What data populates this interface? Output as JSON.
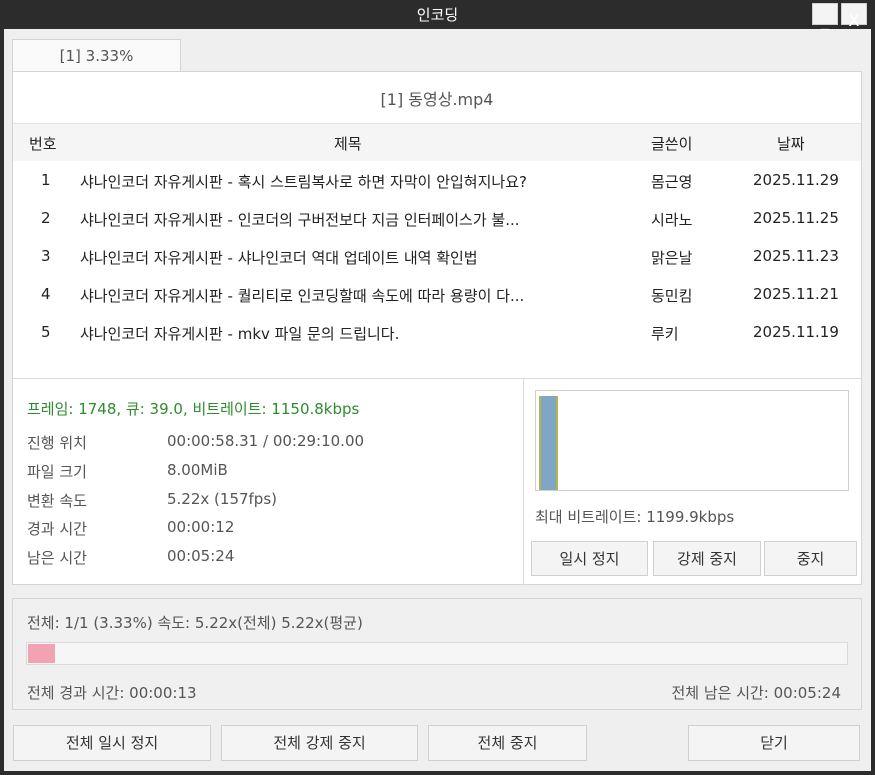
{
  "window": {
    "title": "인코딩",
    "minimize_glyph": "_",
    "close_glyph": "X"
  },
  "tab": {
    "label": "[1] 3.33%"
  },
  "file": {
    "title": "[1] 동영상.mp4"
  },
  "table": {
    "headers": [
      "번호",
      "제목",
      "글쓴이",
      "날짜"
    ],
    "rows": [
      {
        "num": "1",
        "title": "샤나인코더 자유게시판 - 혹시 스트림복사로 하면 자막이 안입혀지나요?",
        "author": "몸근영",
        "date": "2025.11.29"
      },
      {
        "num": "2",
        "title": "샤나인코더 자유게시판 - 인코더의 구버전보다 지금 인터페이스가 불...",
        "author": "시라노",
        "date": "2025.11.25"
      },
      {
        "num": "3",
        "title": "샤나인코더 자유게시판 - 샤나인코더 역대 업데이트 내역 확인법",
        "author": "맑은날",
        "date": "2025.11.23"
      },
      {
        "num": "4",
        "title": "샤나인코더 자유게시판 - 퀄리티로 인코딩할때 속도에 따라 용량이 다...",
        "author": "동민킴",
        "date": "2025.11.21"
      },
      {
        "num": "5",
        "title": "샤나인코더 자유게시판 - mkv 파일 문의 드립니다.",
        "author": "루키",
        "date": "2025.11.19"
      }
    ]
  },
  "stats": {
    "frame_line": "프레임: 1748, 큐: 39.0, 비트레이트: 1150.8kbps",
    "items": [
      {
        "label": "진행 위치",
        "value": "00:00:58.31 / 00:29:10.00"
      },
      {
        "label": "파일 크기",
        "value": "8.00MiB"
      },
      {
        "label": "변환 속도",
        "value": "5.22x (157fps)"
      },
      {
        "label": "경과 시간",
        "value": "00:00:12"
      },
      {
        "label": "남은 시간",
        "value": "00:05:24"
      }
    ],
    "max_bitrate": "최대 비트레이트: 1199.9kbps"
  },
  "graph": {
    "bar_color": "#7fa6c4",
    "edge_color": "#b5b54a"
  },
  "buttons": {
    "pause": "일시 정지",
    "force_stop": "강제 중지",
    "stop": "중지"
  },
  "overall": {
    "summary": "전체: 1/1 (3.33%) 속도: 5.22x(전체) 5.22x(평균)",
    "progress": 0.0333,
    "progress_color": "#f2a3b3",
    "elapsed": "전체 경과 시간: 00:00:13",
    "remaining": "전체 남은 시간: 00:05:24"
  },
  "footer": {
    "pause_all": "전체 일시 정지",
    "force_stop_all": "전체 강제 중지",
    "stop_all": "전체 중지",
    "close": "닫기"
  }
}
